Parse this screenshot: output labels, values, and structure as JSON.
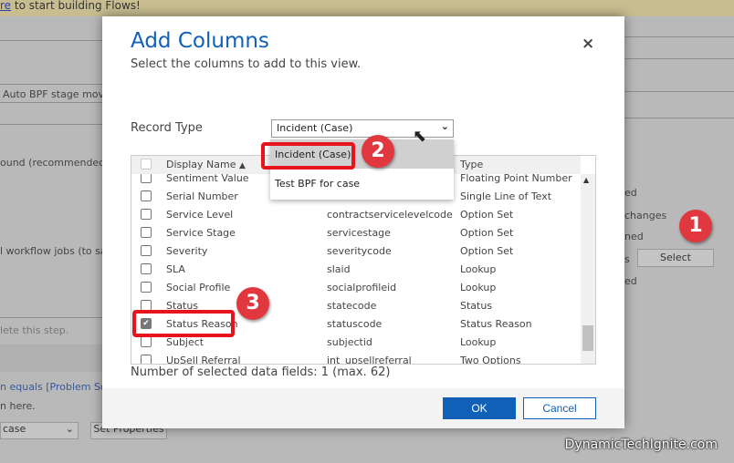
{
  "background": {
    "banner_link": "re",
    "banner_text": " to start building Flows!",
    "field_value": "Auto BPF stage movem",
    "text_background": "ound (recommended)",
    "text_workflow": "l workflow jobs (to save",
    "text_step": "lete this step.",
    "text_condition": "n equals [Problem Solve",
    "text_here": "n here.",
    "dropdown_value": "case",
    "set_properties": "Set Properties",
    "right_texts": [
      "ed",
      "changes",
      "ned",
      "s",
      "ed"
    ],
    "select_button": "Select"
  },
  "dialog": {
    "title": "Add Columns",
    "subtitle": "Select the columns to add to this view.",
    "close_icon": "×",
    "record_type_label": "Record Type",
    "record_type_value": "Incident (Case)",
    "dropdown_options": [
      "Incident (Case)",
      "Test BPF for case"
    ],
    "columns": {
      "display_name": "Display Name",
      "sort": "▲",
      "type": "Type"
    },
    "rows": [
      {
        "name": "Sentiment Value",
        "schema": "",
        "type": "Floating Point Number",
        "checked": false
      },
      {
        "name": "Serial Number",
        "schema": "",
        "type": "Single Line of Text",
        "checked": false
      },
      {
        "name": "Service Level",
        "schema": "contractservicelevelcode",
        "type": "Option Set",
        "checked": false
      },
      {
        "name": "Service Stage",
        "schema": "servicestage",
        "type": "Option Set",
        "checked": false
      },
      {
        "name": "Severity",
        "schema": "severitycode",
        "type": "Option Set",
        "checked": false
      },
      {
        "name": "SLA",
        "schema": "slaid",
        "type": "Lookup",
        "checked": false
      },
      {
        "name": "Social Profile",
        "schema": "socialprofileid",
        "type": "Lookup",
        "checked": false
      },
      {
        "name": "Status",
        "schema": "statecode",
        "type": "Status",
        "checked": false
      },
      {
        "name": "Status Reason",
        "schema": "statuscode",
        "type": "Status Reason",
        "checked": true
      },
      {
        "name": "Subject",
        "schema": "subjectid",
        "type": "Lookup",
        "checked": false
      },
      {
        "name": "UpSell Referral",
        "schema": "int_upsellreferral",
        "type": "Two Options",
        "checked": false
      }
    ],
    "count_text": "Number of selected data fields: 1 (max. 62)",
    "ok": "OK",
    "cancel": "Cancel"
  },
  "badges": [
    "1",
    "2",
    "3"
  ],
  "watermark": "DynamicTechIgnite.com",
  "colors": {
    "accent": "#1160b7",
    "highlight": "#e8141d",
    "badge": "#e0383e"
  }
}
